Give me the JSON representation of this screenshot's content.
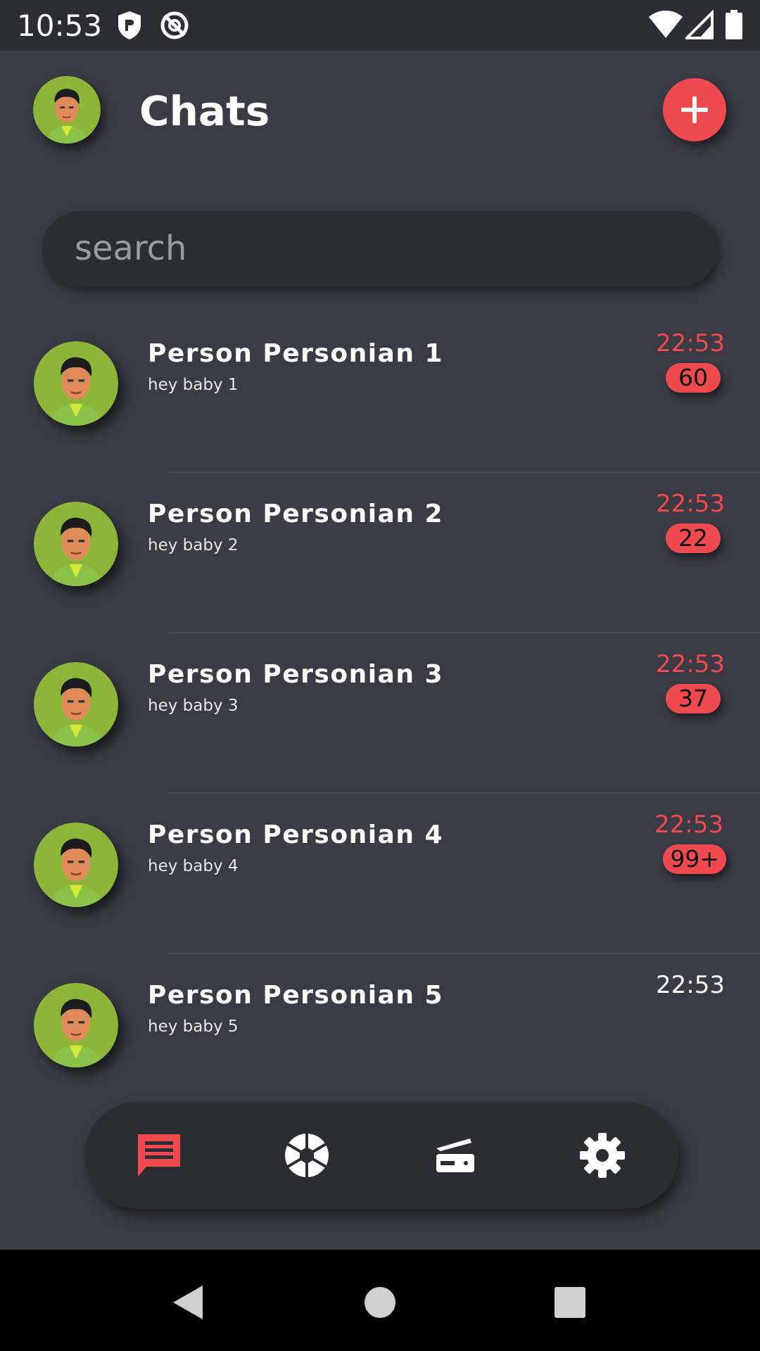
{
  "status_bar": {
    "time": "10:53"
  },
  "header": {
    "title": "Chats",
    "add_button_icon": "plus-icon"
  },
  "search": {
    "placeholder": "search",
    "value": ""
  },
  "chats": [
    {
      "name": "Person Personian 1",
      "preview": "hey baby 1",
      "time": "22:53",
      "unread": "60"
    },
    {
      "name": "Person Personian 2",
      "preview": "hey baby 2",
      "time": "22:53",
      "unread": "22"
    },
    {
      "name": "Person Personian 3",
      "preview": "hey baby 3",
      "time": "22:53",
      "unread": "37"
    },
    {
      "name": "Person Personian 4",
      "preview": "hey baby 4",
      "time": "22:53",
      "unread": "99+"
    },
    {
      "name": "Person Personian 5",
      "preview": "hey baby 5",
      "time": "22:53",
      "unread": ""
    }
  ],
  "bottom_nav": {
    "items": [
      {
        "icon": "chat-icon",
        "active": true
      },
      {
        "icon": "camera-shutter-icon",
        "active": false
      },
      {
        "icon": "scanner-icon",
        "active": false
      },
      {
        "icon": "gear-icon",
        "active": false
      }
    ]
  },
  "colors": {
    "background": "#3a3b44",
    "surface": "#2b2d32",
    "accent": "#ef4a4f",
    "text": "#ffffff"
  }
}
